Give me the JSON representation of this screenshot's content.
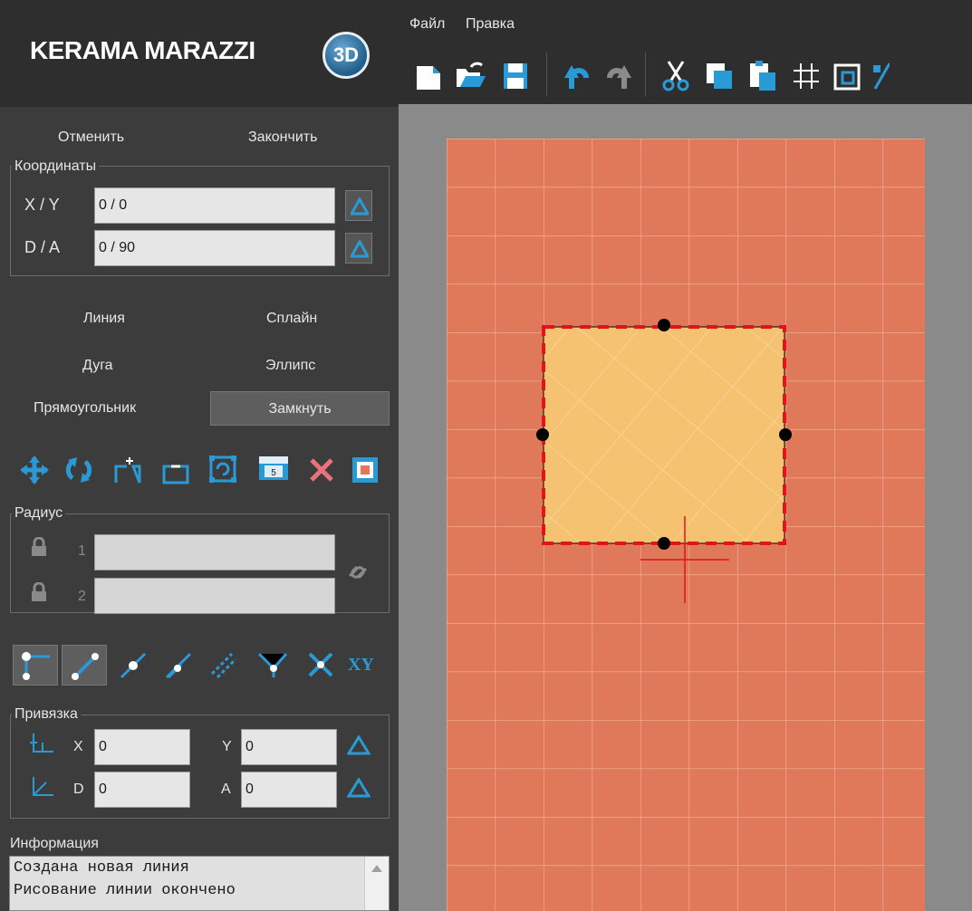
{
  "app": {
    "brand": "KERAMA MARAZZI",
    "badge": "3D"
  },
  "menu": [
    "Файл",
    "Правка"
  ],
  "toolbar_icons": [
    "new-file-icon",
    "open-folder-icon",
    "save-icon",
    "undo-icon",
    "redo-icon",
    "cut-icon",
    "copy-icon",
    "paste-icon",
    "grid-icon",
    "frame-icon",
    "percent-icon"
  ],
  "actions": {
    "cancel": "Отменить",
    "finish": "Закончить"
  },
  "coordinates": {
    "legend": "Координаты",
    "xy_label": "X / Y",
    "xy_value": "0 / 0",
    "da_label": "D / A",
    "da_value": "0 / 90"
  },
  "draw_tools": {
    "line": "Линия",
    "spline": "Сплайн",
    "arc": "Дуга",
    "ellipse": "Эллипс",
    "rectangle": "Прямоугольник",
    "close": "Замкнуть"
  },
  "edit_icons": [
    "move-icon",
    "rotate-icon",
    "add-point-icon",
    "remove-point-icon",
    "transform-icon",
    "measure-icon",
    "delete-icon",
    "preview-icon"
  ],
  "radius": {
    "legend": "Радиус",
    "r1_label": "1",
    "r2_label": "2",
    "r1_value": "",
    "r2_value": ""
  },
  "snap_icons": [
    "snap-endpoint-icon",
    "snap-line-icon",
    "snap-midpoint-icon",
    "snap-angle-icon",
    "snap-parallel-icon",
    "snap-bisector-icon",
    "snap-intersection-icon"
  ],
  "snap_xy": "XY",
  "binding": {
    "legend": "Привязка",
    "x_label": "X",
    "x_value": "0",
    "y_label": "Y",
    "y_value": "0",
    "d_label": "D",
    "d_value": "0",
    "a_label": "A",
    "a_value": "0"
  },
  "information": {
    "title": "Информация",
    "lines": [
      "Создана новая линия",
      "Рисование линии окончено"
    ]
  },
  "colors": {
    "tile": "#e0785a",
    "grout": "#f2b39e",
    "shape_fill": "#f4c271",
    "shape_border": "#e0141a",
    "accent_blue": "#2a9ad6"
  }
}
